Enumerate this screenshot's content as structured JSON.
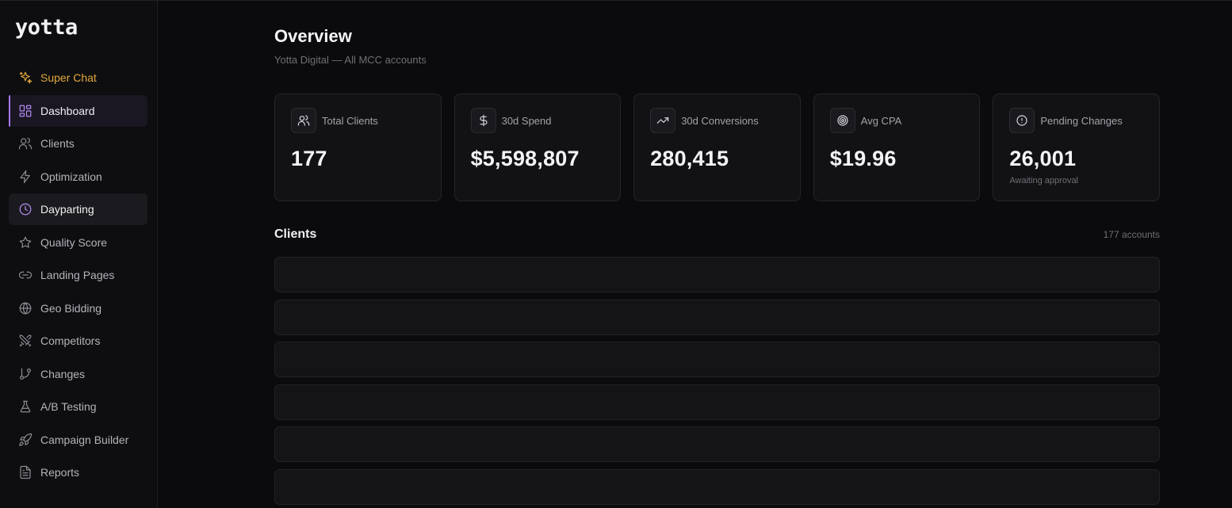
{
  "brand": {
    "logo": "yotta"
  },
  "sidebar": {
    "items": [
      {
        "label": "Super Chat",
        "icon": "sparkles-icon"
      },
      {
        "label": "Dashboard",
        "icon": "dashboard-icon"
      },
      {
        "label": "Clients",
        "icon": "users-icon"
      },
      {
        "label": "Optimization",
        "icon": "bolt-icon"
      },
      {
        "label": "Dayparting",
        "icon": "clock-icon"
      },
      {
        "label": "Quality Score",
        "icon": "star-icon"
      },
      {
        "label": "Landing Pages",
        "icon": "link-icon"
      },
      {
        "label": "Geo Bidding",
        "icon": "globe-icon"
      },
      {
        "label": "Competitors",
        "icon": "swords-icon"
      },
      {
        "label": "Changes",
        "icon": "git-branch-icon"
      },
      {
        "label": "A/B Testing",
        "icon": "flask-icon"
      },
      {
        "label": "Campaign Builder",
        "icon": "rocket-icon"
      },
      {
        "label": "Reports",
        "icon": "file-text-icon"
      }
    ]
  },
  "page": {
    "title": "Overview",
    "subtitle": "Yotta Digital — All MCC accounts"
  },
  "stats": [
    {
      "label": "Total Clients",
      "value": "177",
      "icon": "users-icon"
    },
    {
      "label": "30d Spend",
      "value": "$5,598,807",
      "icon": "dollar-icon"
    },
    {
      "label": "30d Conversions",
      "value": "280,415",
      "icon": "trending-up-icon"
    },
    {
      "label": "Avg CPA",
      "value": "$19.96",
      "icon": "target-icon"
    },
    {
      "label": "Pending Changes",
      "value": "26,001",
      "note": "Awaiting approval",
      "icon": "alert-circle-icon"
    }
  ],
  "clients": {
    "title": "Clients",
    "count": "177 accounts"
  },
  "colors": {
    "accent": "#a678f0",
    "super": "#e3a93b",
    "background": "#0b0b0d"
  }
}
